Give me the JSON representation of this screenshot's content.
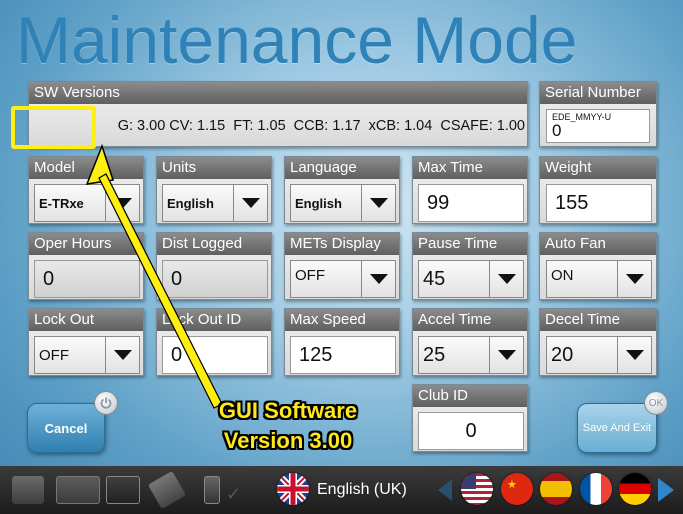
{
  "title": "Maintenance Mode",
  "sw_versions": {
    "header": "SW Versions",
    "line": "G: 3.00 CV: 1.15  FT: 1.05  CCB: 1.17  xCB: 1.04  CSAFE: 1.00"
  },
  "serial": {
    "header": "Serial Number",
    "label": "EDE_MMYY-U",
    "value": "0"
  },
  "model": {
    "header": "Model",
    "value": "E-TRxe"
  },
  "units": {
    "header": "Units",
    "value": "English"
  },
  "language": {
    "header": "Language",
    "value": "English"
  },
  "max_time": {
    "header": "Max Time",
    "value": "99"
  },
  "weight": {
    "header": "Weight",
    "value": "155"
  },
  "oper_hours": {
    "header": "Oper Hours",
    "value": "0"
  },
  "dist_logged": {
    "header": "Dist Logged",
    "value": "0"
  },
  "mets_display": {
    "header": "METs Display",
    "value": "OFF"
  },
  "pause_time": {
    "header": "Pause Time",
    "value": "45"
  },
  "auto_fan": {
    "header": "Auto Fan",
    "value": "ON"
  },
  "lock_out": {
    "header": "Lock Out",
    "value": "OFF"
  },
  "lock_out_id": {
    "header": "Lock Out ID",
    "value": "0"
  },
  "max_speed": {
    "header": "Max Speed",
    "value": "125"
  },
  "accel_time": {
    "header": "Accel Time",
    "value": "25"
  },
  "decel_time": {
    "header": "Decel Time",
    "value": "20"
  },
  "club_id": {
    "header": "Club ID",
    "value": "0"
  },
  "buttons": {
    "cancel": "Cancel",
    "save": "Save And Exit",
    "ok_badge": "OK"
  },
  "annotation": {
    "line1": "GUI Software",
    "line2": "Version 3.00"
  },
  "taskbar": {
    "language_label": "English (UK)"
  },
  "colors": {
    "title": "#2f82b8",
    "annotation": "#ffe81a",
    "header_bg": "#6f6f6f"
  }
}
